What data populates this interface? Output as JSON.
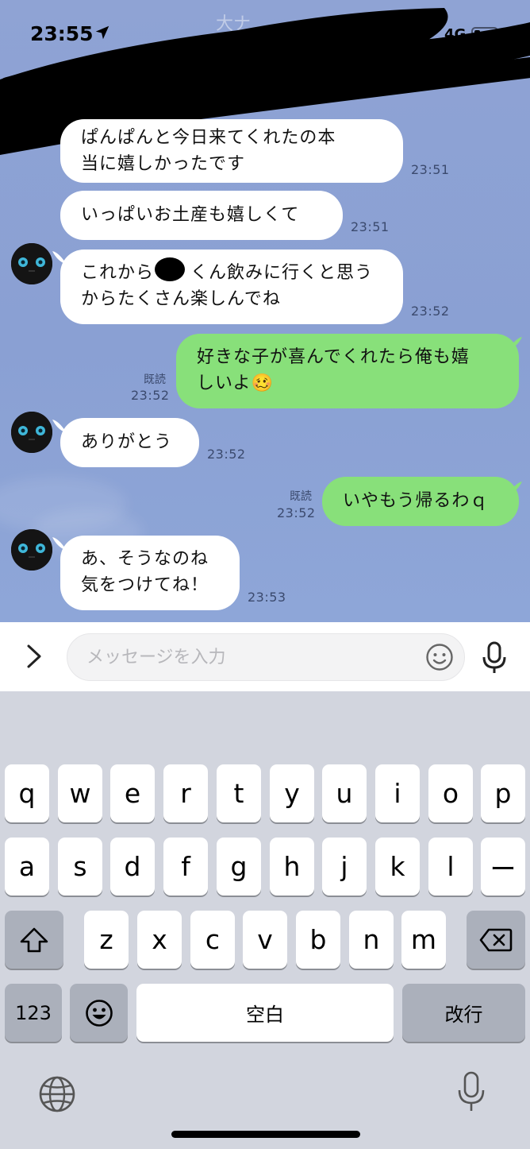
{
  "status_bar": {
    "time": "23:55",
    "network": "4G"
  },
  "header": {
    "title_partial": "大ナ"
  },
  "messages": [
    {
      "id": 1,
      "side": "in",
      "avatar": false,
      "text": "ぱんぱんと今日来てくれたの本\n当に嬉しかったです",
      "time": "23:51"
    },
    {
      "id": 2,
      "side": "in",
      "avatar": false,
      "text": "いっぱいお土産も嬉しくて",
      "time": "23:51"
    },
    {
      "id": 3,
      "side": "in",
      "avatar": true,
      "text": "これから　　くん飲みに行くと思う\nからたくさん楽しんでね",
      "time": "23:52"
    },
    {
      "id": 4,
      "side": "out",
      "text": "好きな子が喜んでくれたら俺も嬉\nしいよ🥴",
      "time": "23:52",
      "read": "既読"
    },
    {
      "id": 5,
      "side": "in",
      "avatar": true,
      "text": "ありがとう",
      "time": "23:52"
    },
    {
      "id": 6,
      "side": "out",
      "text": "いやもう帰るわｑ",
      "time": "23:52",
      "read": "既読"
    },
    {
      "id": 7,
      "side": "in",
      "avatar": true,
      "text": "あ、そうなのね\n気をつけてね！",
      "time": "23:53"
    }
  ],
  "input": {
    "placeholder": "メッセージを入力",
    "value": ""
  },
  "keyboard": {
    "row1": [
      "q",
      "w",
      "e",
      "r",
      "t",
      "y",
      "u",
      "i",
      "o",
      "p"
    ],
    "row2": [
      "a",
      "s",
      "d",
      "f",
      "g",
      "h",
      "j",
      "k",
      "l",
      "ー"
    ],
    "row3": [
      "z",
      "x",
      "c",
      "v",
      "b",
      "n",
      "m"
    ],
    "numbers_label": "123",
    "space_label": "空白",
    "return_label": "改行"
  },
  "icons": {
    "location": "location-arrow-icon",
    "battery": "battery-icon",
    "expand": "chevron-right-icon",
    "emoji": "smiley-icon",
    "mic": "microphone-icon",
    "shift": "shift-arrow-icon",
    "backspace": "backspace-icon",
    "emoji_key": "emoji-face-icon",
    "globe": "globe-icon",
    "dictation": "dictation-mic-icon"
  },
  "colors": {
    "chat_background": "#8fa3d4",
    "incoming_bubble": "#ffffff",
    "outgoing_bubble": "#88e07a",
    "keyboard_background": "#d2d5de"
  }
}
